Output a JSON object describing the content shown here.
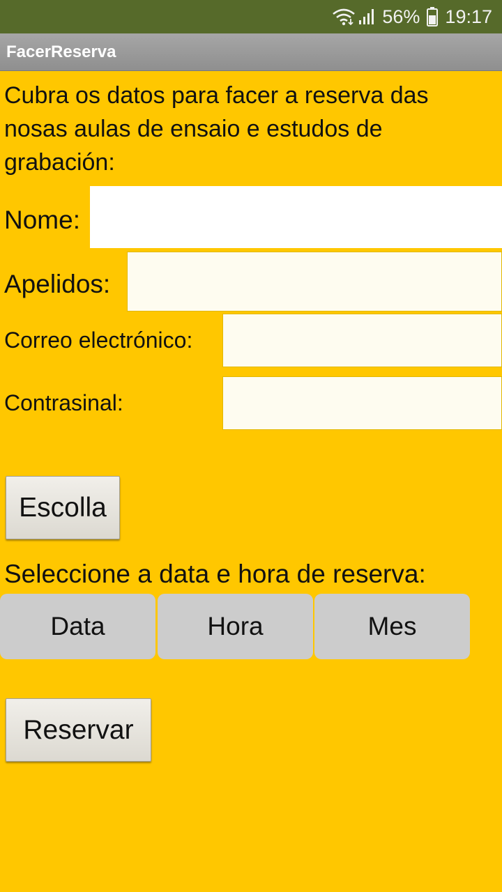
{
  "status_bar": {
    "battery_percent": "56%",
    "time": "19:17",
    "wifi_icon": "wifi-icon",
    "signal_icon": "signal-icon",
    "battery_icon": "battery-icon",
    "background_color": "#566A2A"
  },
  "app": {
    "title": "FacerReserva"
  },
  "form": {
    "intro_text": "Cubra os datos para facer a reserva das nosas aulas de ensaio e estudos de grabación:",
    "name_label": "Nome:",
    "name_value": "",
    "surname_label": "Apelidos:",
    "surname_value": "",
    "email_label": "Correo electrónico:",
    "email_value": "",
    "password_label": "Contrasinal:",
    "password_value": "",
    "choose_button": "Escolla",
    "date_prompt": "Seleccione a data e hora de reserva:",
    "date_button": "Data",
    "time_button": "Hora",
    "month_button": "Mes",
    "reserve_button": "Reservar"
  },
  "colors": {
    "background": "#FFC700",
    "segment_button": "#CCCCCC"
  }
}
